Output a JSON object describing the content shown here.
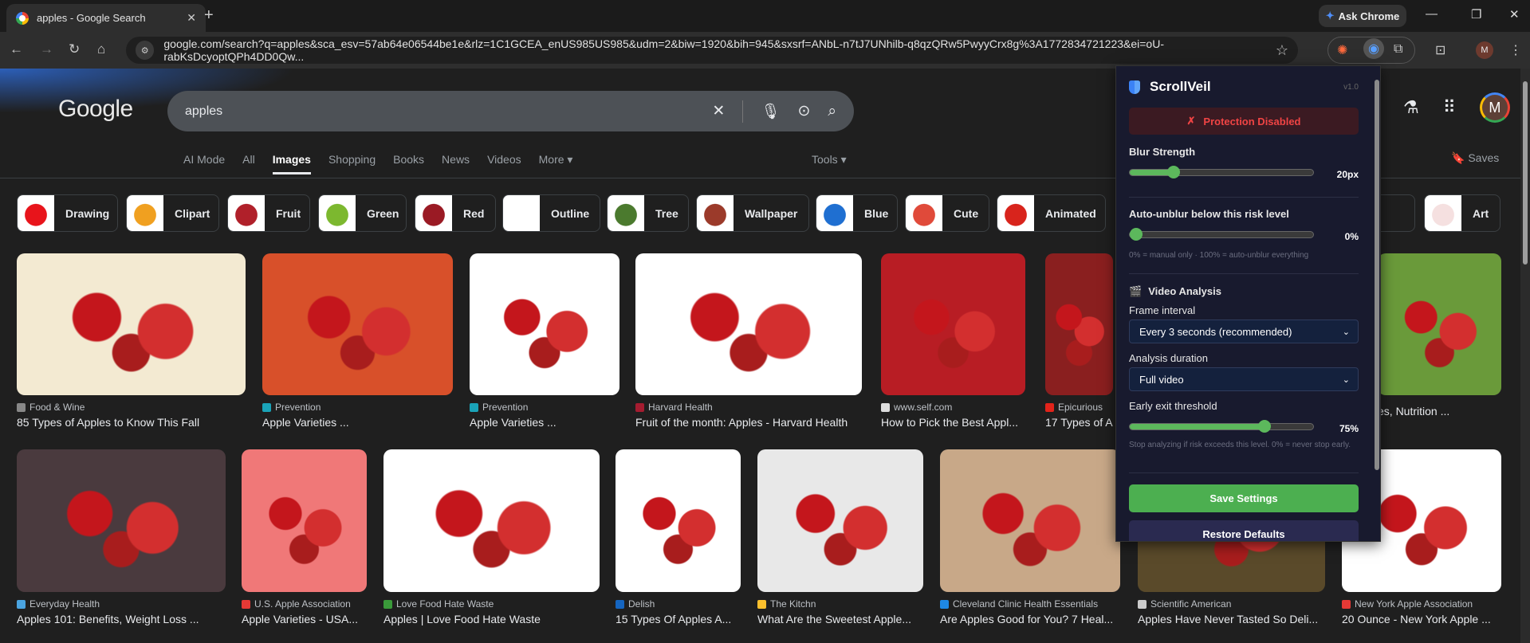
{
  "browser": {
    "tab_title": "apples - Google Search",
    "new_tab": "+",
    "ask_chrome": "Ask Chrome",
    "url": "google.com/search?q=apples&sca_esv=57ab64e06544be1e&rlz=1C1GCEA_enUS985US985&udm=2&biw=1920&bih=945&sxsrf=ANbL-n7tJ7UNhilb-q8qzQRw5PwyyCrx8g%3A1772834721223&ei=oU-rabKsDcyoptQPh4DD0Qw...",
    "profile_initial": "M"
  },
  "google": {
    "logo": "Google",
    "query": "apples",
    "profile_initial": "M",
    "nav": [
      {
        "label": "AI Mode"
      },
      {
        "label": "All"
      },
      {
        "label": "Images",
        "active": true
      },
      {
        "label": "Shopping"
      },
      {
        "label": "Books"
      },
      {
        "label": "News"
      },
      {
        "label": "Videos"
      },
      {
        "label": "More ▾"
      }
    ],
    "tools": "Tools ▾",
    "saves": "Saves",
    "chips": [
      {
        "label": "Drawing",
        "color": "#e8141b"
      },
      {
        "label": "Clipart",
        "color": "#f0a020"
      },
      {
        "label": "Fruit",
        "color": "#b0202a"
      },
      {
        "label": "Green",
        "color": "#7cb82f"
      },
      {
        "label": "Red",
        "color": "#9a1a24"
      },
      {
        "label": "Outline",
        "color": "#ffffff"
      },
      {
        "label": "Tree",
        "color": "#4b7a2e"
      },
      {
        "label": "Wallpaper",
        "color": "#9b3a2a"
      },
      {
        "label": "Blue",
        "color": "#1f6fd1"
      },
      {
        "label": "Cute",
        "color": "#e04a3a"
      },
      {
        "label": "Animated",
        "color": "#d8241c"
      },
      {
        "label": "able",
        "color": "#2a2a2a"
      },
      {
        "label": "Art",
        "color": "#f5e0e0"
      }
    ],
    "results_row1": [
      {
        "source": "Food & Wine",
        "title": "85 Types of Apples to Know This Fall",
        "color": "#f3ead2",
        "fav": "#888"
      },
      {
        "source": "Prevention",
        "title": "Apple Varieties ...",
        "color": "#d8502a",
        "fav": "#1aa3b8"
      },
      {
        "source": "Prevention",
        "title": "Apple Varieties ...",
        "color": "#ffffff",
        "fav": "#1aa3b8"
      },
      {
        "source": "Harvard Health",
        "title": "Fruit of the month: Apples - Harvard Health",
        "color": "#ffffff",
        "fav": "#a51c30"
      },
      {
        "source": "www.self.com",
        "title": "How to Pick the Best Appl...",
        "color": "#b81d24",
        "fav": "#ddd"
      },
      {
        "source": "Epicurious",
        "title": "17 Types of A",
        "color": "#8a1f1f",
        "fav": "#e2231a"
      },
      {
        "source": "",
        "title": "es, Nutrition ...",
        "color": "#6a9a3a",
        "fav": ""
      }
    ],
    "results_row2": [
      {
        "source": "Everyday Health",
        "title": "Apples 101: Benefits, Weight Loss ...",
        "color": "#4a3a3e",
        "fav": "#4aa3df"
      },
      {
        "source": "U.S. Apple Association",
        "title": "Apple Varieties - USA...",
        "color": "#f07878",
        "fav": "#e53935"
      },
      {
        "source": "Love Food Hate Waste",
        "title": "Apples | Love Food Hate Waste",
        "color": "#ffffff",
        "fav": "#3a9a3a"
      },
      {
        "source": "Delish",
        "title": "15 Types Of Apples A...",
        "color": "#ffffff",
        "fav": "#1565c0"
      },
      {
        "source": "The Kitchn",
        "title": "What Are the Sweetest Apple...",
        "color": "#e8e8e8",
        "fav": "#fbc02d"
      },
      {
        "source": "Cleveland Clinic Health Essentials",
        "title": "Are Apples Good for You? 7 Heal...",
        "color": "#c8a888",
        "fav": "#1e88e5"
      },
      {
        "source": "Scientific American",
        "title": "Apples Have Never Tasted So Deli...",
        "color": "#5a4a2a",
        "fav": "#ccc"
      },
      {
        "source": "New York Apple Association",
        "title": "20 Ounce - New York Apple ...",
        "color": "#ffffff",
        "fav": "#e53935"
      }
    ]
  },
  "extension": {
    "name": "ScrollVeil",
    "version": "v1.0",
    "status": "Protection Disabled",
    "status_icon": "✗",
    "blur_label": "Blur Strength",
    "blur_value": "20px",
    "blur_fraction": 0.22,
    "auto_label": "Auto-unblur below this risk level",
    "auto_value": "0%",
    "auto_fraction": 0,
    "auto_hint": "0% = manual only · 100% = auto-unblur everything",
    "video_heading": "Video Analysis",
    "frame_label": "Frame interval",
    "frame_value": "Every 3 seconds (recommended)",
    "duration_label": "Analysis duration",
    "duration_value": "Full video",
    "exit_label": "Early exit threshold",
    "exit_value": "75%",
    "exit_fraction": 0.75,
    "exit_hint": "Stop analyzing if risk exceeds this level. 0% = never stop early.",
    "save": "Save Settings",
    "restore": "Restore Defaults",
    "accent": "#5cb85c"
  }
}
